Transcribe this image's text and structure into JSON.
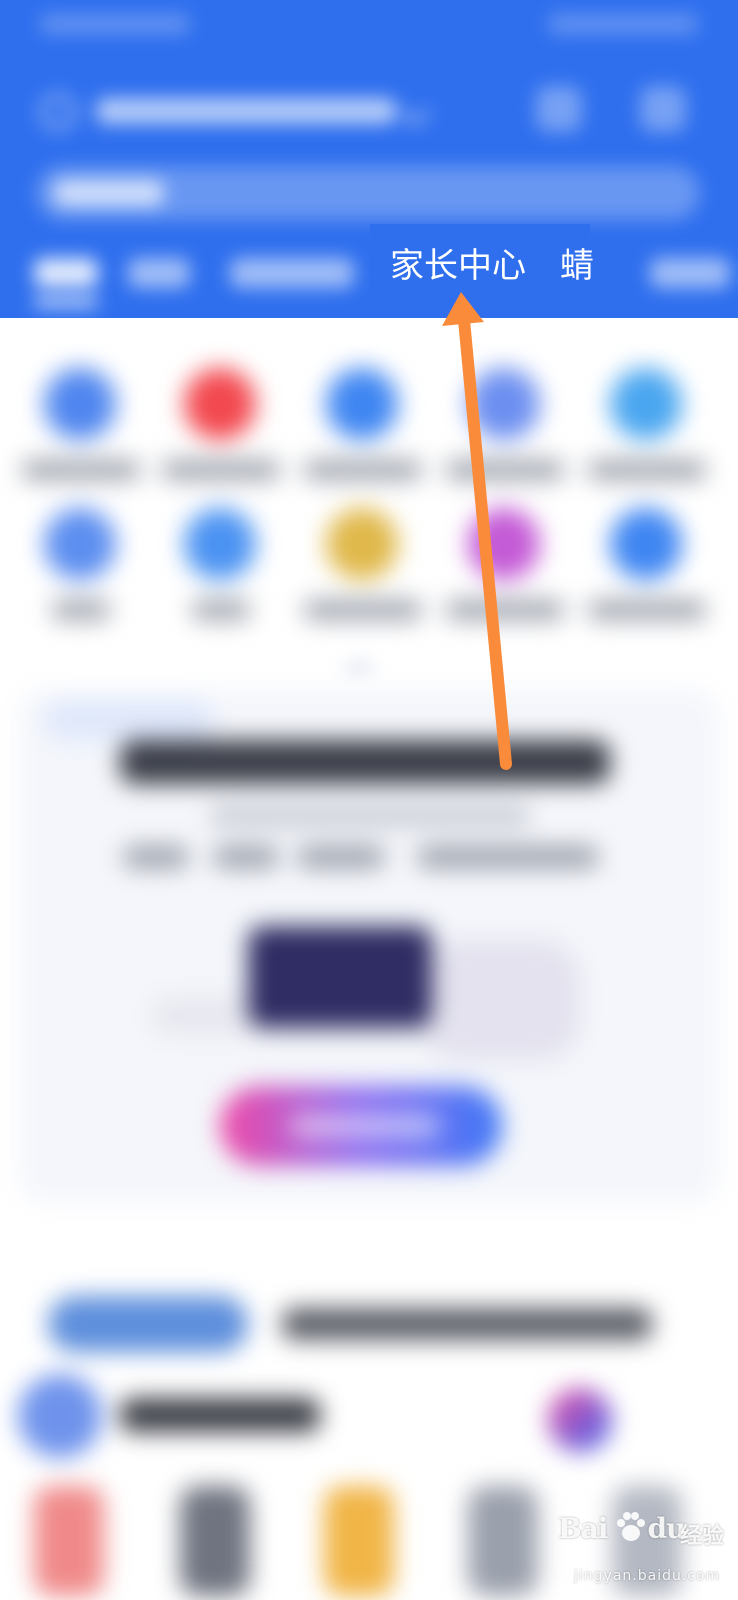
{
  "header": {
    "background_color": "#2f6fee",
    "tabs": [
      {
        "label": ""
      },
      {
        "label": ""
      },
      {
        "label": ""
      },
      {
        "label": "家长中心"
      },
      {
        "label": "蜻"
      },
      {
        "label": ""
      }
    ],
    "icons": [
      "location-icon",
      "message-icon",
      "settings-icon"
    ]
  },
  "annotation": {
    "type": "arrow",
    "color": "#f98b3a",
    "target": "家长中心"
  },
  "watermark": {
    "brand_latin": "Bai",
    "brand_latin_2": "du",
    "brand_cn": "经验",
    "url": "jingyan.baidu.com"
  }
}
